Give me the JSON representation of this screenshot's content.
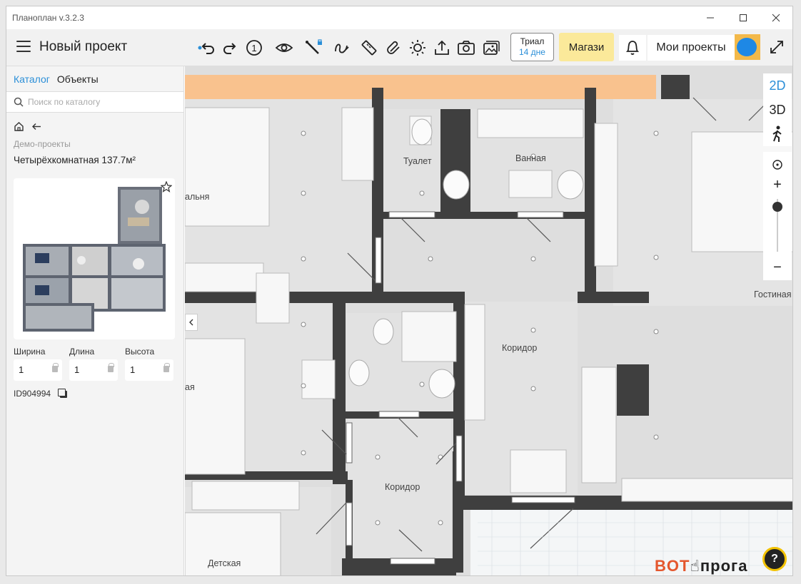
{
  "app": {
    "title": "Планоплан v.3.2.3",
    "project_title": "Новый проект"
  },
  "toolbar": {
    "tools": [
      "undo-icon",
      "redo-icon",
      "floor-number-icon",
      "eye-icon",
      "ruler-lock-icon",
      "path-icon",
      "tape-measure-icon",
      "clip-icon",
      "sun-icon",
      "upload-icon",
      "camera-icon",
      "gallery-icon"
    ],
    "floor_number": "1",
    "trial_label": "Триал",
    "trial_days": "14 дне",
    "shop_label": "Магази",
    "my_projects_label": "Мои проекты"
  },
  "sidebar": {
    "tabs": [
      {
        "label": "Каталог",
        "active": true
      },
      {
        "label": "Объекты",
        "active": false
      }
    ],
    "search_placeholder": "Поиск по каталогу",
    "section": "Демо-проекты",
    "project_name": "Четырёхкомнатная 137.7м²",
    "dimensions": [
      {
        "label": "Ширина",
        "value": "1"
      },
      {
        "label": "Длина",
        "value": "1"
      },
      {
        "label": "Высота",
        "value": "1"
      }
    ],
    "id_label": "ID904994"
  },
  "plan": {
    "rooms": [
      "Туалет",
      "Ванная",
      "альня",
      "Коридор",
      "Коридор",
      "Гостиная",
      "ая",
      "Детская"
    ]
  },
  "view": {
    "mode_2d": "2D",
    "mode_3d": "3D",
    "zoom_in": "+",
    "zoom_out": "−"
  },
  "help_label": "?",
  "watermark": {
    "part1": "BOT",
    "part2": "прога"
  },
  "colors": {
    "accent": "#2b8fd8",
    "shop_bg": "#fbe99a",
    "wall": "#3f3f3f",
    "balcony": "#f9c28e"
  }
}
